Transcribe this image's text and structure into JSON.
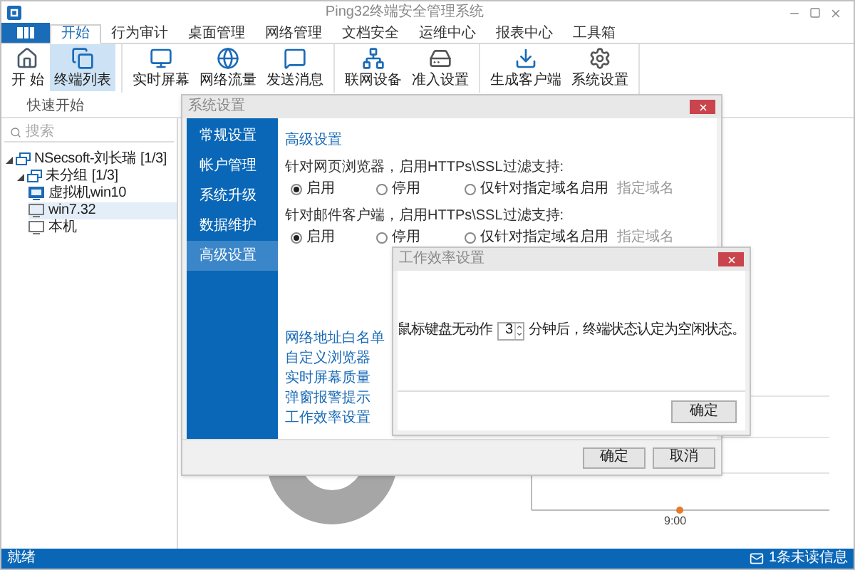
{
  "window": {
    "title": "Ping32终端安全管理系统"
  },
  "menu_tabs": [
    {
      "label": "开始",
      "selected": true
    },
    {
      "label": "行为审计",
      "selected": false
    },
    {
      "label": "桌面管理",
      "selected": false
    },
    {
      "label": "网络管理",
      "selected": false
    },
    {
      "label": "文档安全",
      "selected": false
    },
    {
      "label": "运维中心",
      "selected": false
    },
    {
      "label": "报表中心",
      "selected": false
    },
    {
      "label": "工具箱",
      "selected": false
    }
  ],
  "ribbon": {
    "group_label": "快速开始",
    "buttons": [
      {
        "label": "开 始",
        "kind": "home",
        "selected": false
      },
      {
        "label": "终端列表",
        "kind": "terminals",
        "selected": true
      },
      {
        "label": "实时屏幕",
        "kind": "screen",
        "selected": false
      },
      {
        "label": "网络流量",
        "kind": "traffic",
        "selected": false
      },
      {
        "label": "发送消息",
        "kind": "message",
        "selected": false
      },
      {
        "label": "联网设备",
        "kind": "devices",
        "selected": false
      },
      {
        "label": "准入设置",
        "kind": "access",
        "selected": false
      },
      {
        "label": "生成客户端",
        "kind": "client",
        "selected": false
      },
      {
        "label": "系统设置",
        "kind": "settings",
        "selected": false
      }
    ]
  },
  "sidebar": {
    "search": {
      "placeholder": "搜索"
    },
    "tree": [
      {
        "label": "NSecsoft-刘长瑞",
        "count": "[1/3]",
        "kind": "group",
        "expanded": true,
        "selected": false,
        "children": [
          {
            "label": "未分组",
            "count": "[1/3]",
            "kind": "group",
            "expanded": true,
            "selected": false,
            "children": [
              {
                "label": "虚拟机win10",
                "kind": "online",
                "selected": false
              },
              {
                "label": "win7.32",
                "kind": "offline",
                "selected": true
              },
              {
                "label": "本机",
                "kind": "offline",
                "selected": false
              }
            ]
          }
        ]
      }
    ]
  },
  "dashboard": {
    "time_label": "9:00"
  },
  "settings_dialog": {
    "title": "系统设置",
    "nav": [
      {
        "label": "常规设置",
        "selected": false
      },
      {
        "label": "帐户管理",
        "selected": false
      },
      {
        "label": "系统升级",
        "selected": false
      },
      {
        "label": "数据维护",
        "selected": false
      },
      {
        "label": "高级设置",
        "selected": true
      }
    ],
    "heading": "高级设置",
    "groups": [
      {
        "label": "针对网页浏览器，启用HTTPs\\SSL过滤支持:",
        "domain_link": "指定域名",
        "options": [
          {
            "label": "启用",
            "selected": true
          },
          {
            "label": "停用",
            "selected": false
          },
          {
            "label": "仅针对指定域名启用",
            "selected": false
          }
        ]
      },
      {
        "label": "针对邮件客户端，启用HTTPs\\SSL过滤支持:",
        "domain_link": "指定域名",
        "options": [
          {
            "label": "启用",
            "selected": true
          },
          {
            "label": "停用",
            "selected": false
          },
          {
            "label": "仅针对指定域名启用",
            "selected": false
          }
        ]
      }
    ],
    "links": [
      "网络地址白名单",
      "自定义浏览器",
      "实时屏幕质量",
      "弹窗报警提示",
      "工作效率设置"
    ],
    "buttons": [
      "确定",
      "取消"
    ]
  },
  "efficiency_dialog": {
    "title": "工作效率设置",
    "prefix": "鼠标键盘无动作",
    "minutes": "3",
    "suffix": "分钟后，终端状态认定为空闲状态。",
    "button": "确定"
  },
  "status_bar": {
    "text": "就绪",
    "messages": "1条未读信息"
  }
}
